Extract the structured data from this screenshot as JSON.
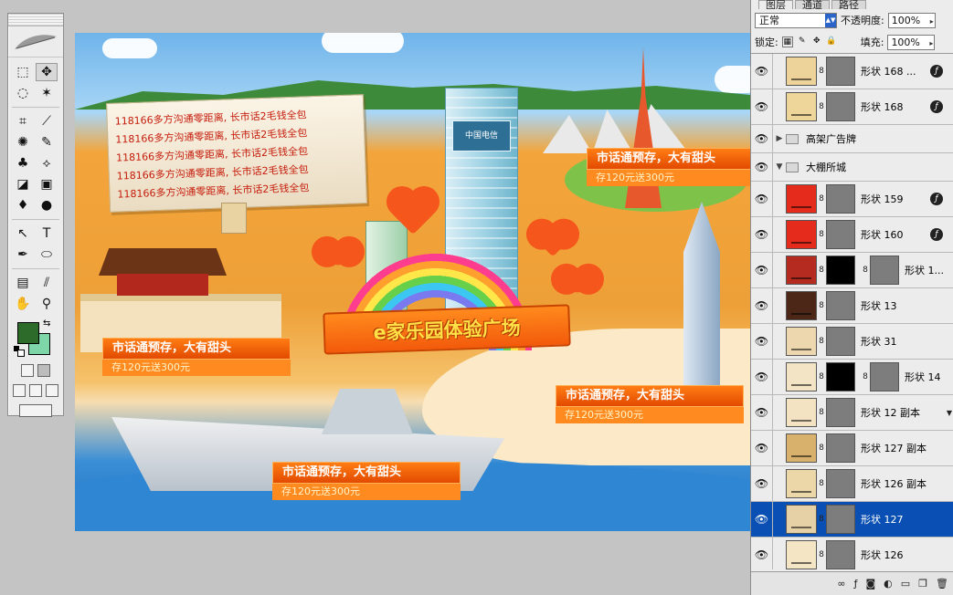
{
  "tools": {
    "items": [
      "⬚",
      "✥",
      "◌",
      "✶",
      "⌗",
      "⟋",
      "✺",
      "✎",
      "♣",
      "⟡",
      "◪",
      "▣",
      "♦",
      "●",
      "↖",
      "T",
      "✒",
      "⬭",
      "▤",
      "⫽",
      "✋",
      "⚲"
    ],
    "fg_color": "#2d6b2a",
    "bg_color": "#7ed6a8"
  },
  "canvas": {
    "board_lines": [
      "118166多方沟通零距离, 长市话2毛钱全包",
      "118166多方沟通零距离, 长市话2毛钱全包",
      "118166多方沟通零距离, 长市话2毛钱全包",
      "118166多方沟通零距离, 长市话2毛钱全包",
      "118166多方沟通零距离, 长市话2毛钱全包"
    ],
    "tower_sign": "中国电信",
    "banner_title": "e家乐园体验广场",
    "promos": [
      {
        "title": "市话通预存，大有甜头",
        "sub": "存120元送300元"
      },
      {
        "title": "市话通预存，大有甜头",
        "sub": "存120元送300元"
      },
      {
        "title": "市话通预存，大有甜头",
        "sub": "存120元送300元"
      },
      {
        "title": "市话通预存，大有甜头",
        "sub": "存120元送300元"
      }
    ]
  },
  "layers_panel": {
    "tabs": [
      "图层",
      "通道",
      "路径"
    ],
    "blend_mode": "正常",
    "opacity_label": "不透明度:",
    "opacity": "100%",
    "lock_label": "锁定:",
    "fill_label": "填充:",
    "fill": "100%",
    "layers": [
      {
        "name": "形状 168 ...",
        "kind": "shape",
        "color": "#edd39a",
        "mask": "gray",
        "fx": true
      },
      {
        "name": "形状 168",
        "kind": "shape",
        "color": "#eed69b",
        "mask": "gray",
        "fx": true
      },
      {
        "name": "高架广告牌",
        "kind": "group",
        "expanded": false
      },
      {
        "name": "大棚所城",
        "kind": "group",
        "expanded": true
      },
      {
        "name": "形状 159",
        "kind": "shape",
        "color": "#e42b1c",
        "mask": "gray",
        "fx": true
      },
      {
        "name": "形状 160",
        "kind": "shape",
        "color": "#e42b1c",
        "mask": "gray",
        "fx": true
      },
      {
        "name": "形状 1...",
        "kind": "shape",
        "color": "#b52b1f",
        "mask": "black",
        "mask2": true
      },
      {
        "name": "形状 13",
        "kind": "shape",
        "color": "#4c2718",
        "mask": "gray"
      },
      {
        "name": "形状 31",
        "kind": "shape",
        "color": "#ecd7ae",
        "mask": "gray"
      },
      {
        "name": "形状 14",
        "kind": "shape",
        "color": "#f2e4c4",
        "mask": "black",
        "mask2": true
      },
      {
        "name": "形状 12 副本",
        "kind": "shape",
        "color": "#f3e3c2",
        "mask": "gray",
        "scroll": true
      },
      {
        "name": "形状 127 副本",
        "kind": "shape",
        "color": "#d8b26c",
        "mask": "gray"
      },
      {
        "name": "形状 126 副本",
        "kind": "shape",
        "color": "#ecd7a8",
        "mask": "gray"
      },
      {
        "name": "形状 127",
        "kind": "shape",
        "color": "#e6d1a6",
        "mask": "gray",
        "selected": true
      },
      {
        "name": "形状 126",
        "kind": "shape",
        "color": "#f4e5c5",
        "mask": "gray"
      }
    ],
    "bottom_icons": [
      "∞",
      "ƒ",
      "◙",
      "◐",
      "▭",
      "❐",
      "🗑"
    ]
  }
}
